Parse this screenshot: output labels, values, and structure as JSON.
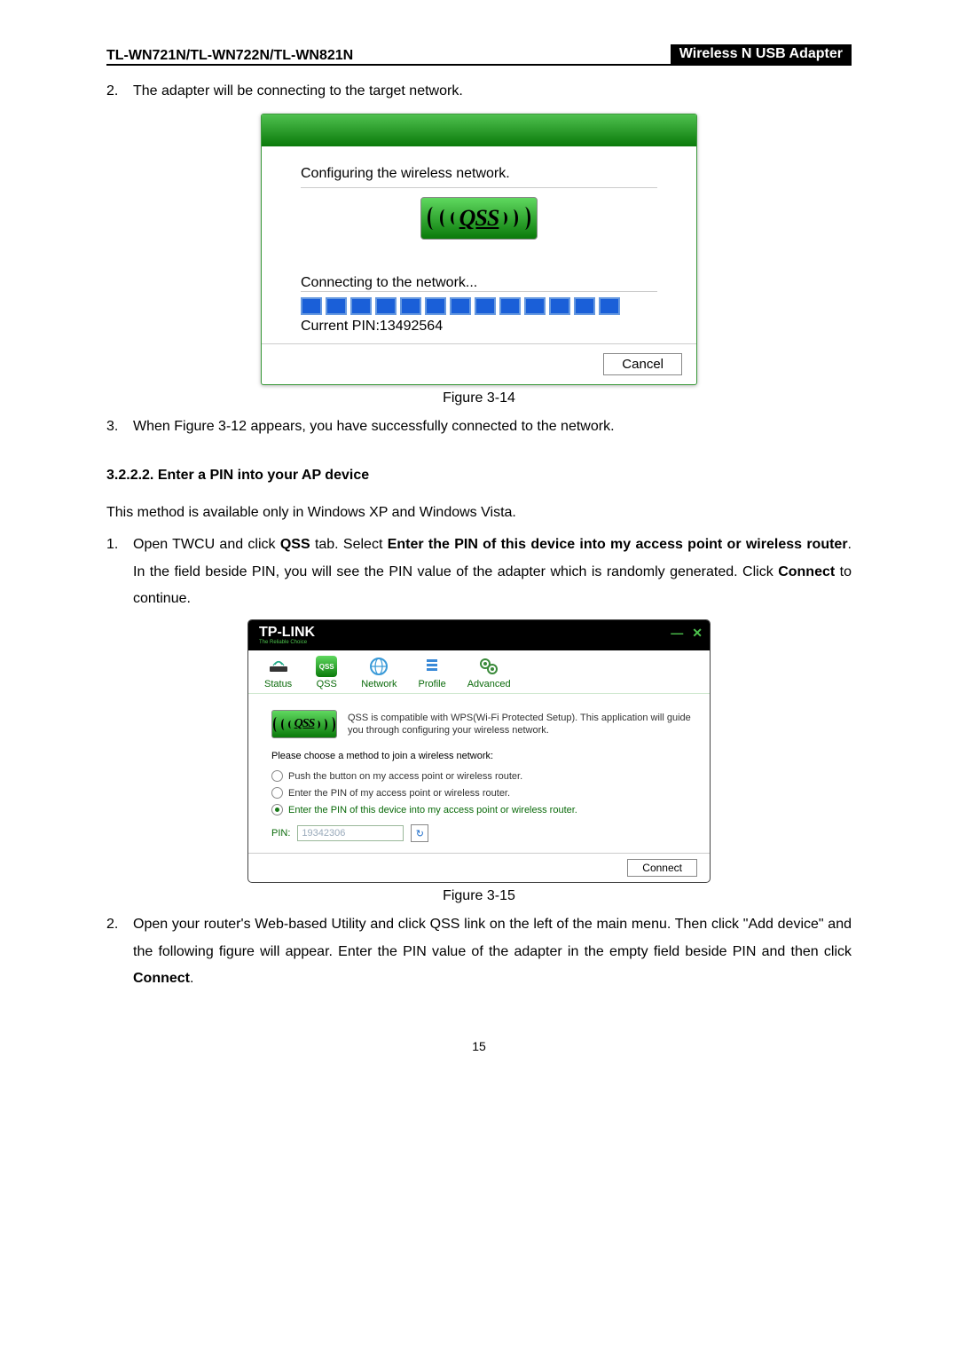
{
  "header": {
    "left": "TL-WN721N/TL-WN722N/TL-WN821N",
    "right": "Wireless N USB Adapter"
  },
  "items": {
    "n2": "2.",
    "t2": "The adapter will be connecting to the target network.",
    "n3": "3.",
    "t3": "When Figure 3-12 appears, you have successfully connected to the network.",
    "n2b": "2.",
    "t2b_a": "Open your router's Web-based Utility and click QSS link on the left of the main menu. Then click \"Add device\" and the following figure will appear. Enter the PIN value of the adapter in the empty field beside PIN and then click ",
    "t2b_b": "Connect",
    "t2b_c": "."
  },
  "fig314": {
    "configuring": "Configuring the wireless network.",
    "qss": "QSS",
    "connecting": "Connecting to the network...",
    "currentPin": "Current PIN:13492564",
    "cancel": "Cancel",
    "caption": "Figure 3-14"
  },
  "section": {
    "heading": "3.2.2.2.  Enter a PIN into your AP device",
    "intro": "This method is available only in Windows XP and Windows Vista.",
    "step1_num": "1.",
    "step1_a": "Open TWCU and click ",
    "step1_b": "QSS",
    "step1_c": " tab. Select ",
    "step1_d": "Enter the PIN of this device into my access point or wireless router",
    "step1_e": ". In the field beside PIN, you will see the PIN value of the adapter which is randomly generated. Click ",
    "step1_f": "Connect",
    "step1_g": " to continue."
  },
  "fig315": {
    "brand": "TP-LINK",
    "brandSub": "The Reliable Choice",
    "minimize": "—",
    "close": "✕",
    "tabs": {
      "status": "Status",
      "qss": "QSS",
      "network": "Network",
      "profile": "Profile",
      "advanced": "Advanced"
    },
    "qssBadge": "QSS",
    "desc": "QSS is compatible with WPS(Wi-Fi Protected Setup). This application will guide you through configuring your wireless network.",
    "choose": "Please choose a method to join a wireless network:",
    "opt1": "Push the button on my access point or wireless router.",
    "opt2": "Enter the PIN of my access point or wireless router.",
    "opt3": "Enter the PIN of this device into my access point or wireless router.",
    "pinLabel": "PIN:",
    "pinValue": "19342306",
    "refresh": "↻",
    "connect": "Connect",
    "caption": "Figure 3-15"
  },
  "pageNumber": "15"
}
